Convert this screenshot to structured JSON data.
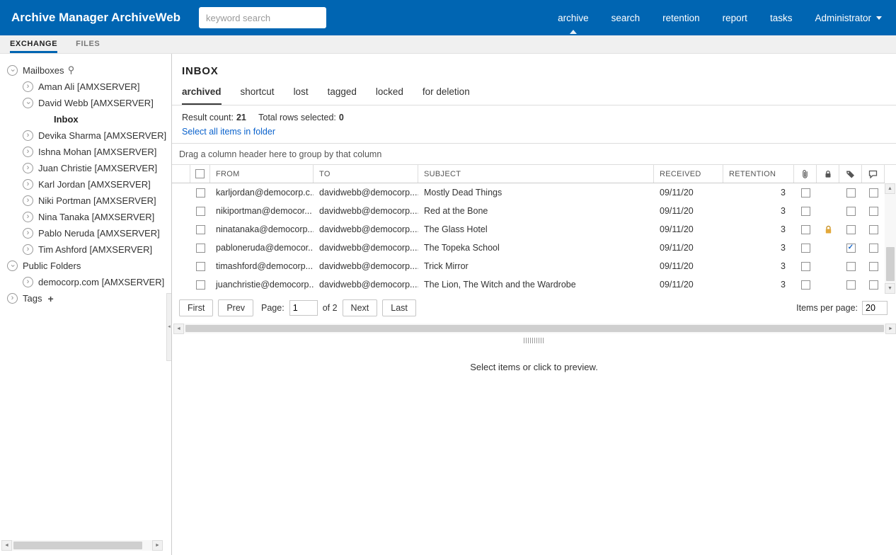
{
  "colors": {
    "accent": "#0065b2",
    "link": "#0a62cc",
    "lock_icon": "#e3a83a",
    "check": "#1464c8"
  },
  "glyphs": {
    "up": "▲",
    "down": "▼",
    "left": "◄",
    "right": "►",
    "chevron": "›",
    "check": "✓",
    "plus": "+"
  },
  "header": {
    "title": "Archive Manager ArchiveWeb",
    "search": {
      "placeholder": "keyword search"
    },
    "nav": [
      {
        "label": "archive",
        "active": true,
        "caret": "up"
      },
      {
        "label": "search"
      },
      {
        "label": "retention"
      },
      {
        "label": "report"
      },
      {
        "label": "tasks"
      },
      {
        "label": "Administrator",
        "caret": "down"
      }
    ]
  },
  "module_tabs": [
    {
      "label": "EXCHANGE",
      "active": true
    },
    {
      "label": "FILES",
      "active": false
    }
  ],
  "sidebar": {
    "tree": [
      {
        "label": "Mailboxes",
        "level": 0,
        "state": "expanded",
        "pin": true
      },
      {
        "label": "Aman Ali [AMXSERVER]",
        "level": 1,
        "state": "collapsed"
      },
      {
        "label": "David Webb [AMXSERVER]",
        "level": 1,
        "state": "expanded"
      },
      {
        "label": "Inbox",
        "level": 2,
        "selected": true
      },
      {
        "label": "Devika Sharma [AMXSERVER]",
        "level": 1,
        "state": "collapsed"
      },
      {
        "label": "Ishna Mohan [AMXSERVER]",
        "level": 1,
        "state": "collapsed"
      },
      {
        "label": "Juan Christie [AMXSERVER]",
        "level": 1,
        "state": "collapsed"
      },
      {
        "label": "Karl Jordan [AMXSERVER]",
        "level": 1,
        "state": "collapsed"
      },
      {
        "label": "Niki Portman [AMXSERVER]",
        "level": 1,
        "state": "collapsed"
      },
      {
        "label": "Nina Tanaka [AMXSERVER]",
        "level": 1,
        "state": "collapsed"
      },
      {
        "label": "Pablo Neruda [AMXSERVER]",
        "level": 1,
        "state": "collapsed"
      },
      {
        "label": "Tim Ashford [AMXSERVER]",
        "level": 1,
        "state": "collapsed"
      },
      {
        "label": "Public Folders",
        "level": 0,
        "state": "expanded"
      },
      {
        "label": "democorp.com [AMXSERVER]",
        "level": 1,
        "state": "collapsed"
      },
      {
        "label": "Tags",
        "level": 0,
        "state": "collapsed",
        "add": true
      }
    ]
  },
  "main": {
    "title": "INBOX",
    "view_tabs": [
      {
        "label": "archived",
        "active": true
      },
      {
        "label": "shortcut"
      },
      {
        "label": "lost"
      },
      {
        "label": "tagged"
      },
      {
        "label": "locked"
      },
      {
        "label": "for deletion"
      }
    ],
    "result_bar": {
      "result_count_label": "Result count:",
      "result_count": "21",
      "rows_selected_label": "Total rows selected:",
      "rows_selected": "0",
      "select_all_link": "Select all items in folder"
    },
    "group_hint": "Drag a column header here to group by that column",
    "table": {
      "columns": [
        "FROM",
        "TO",
        "SUBJECT",
        "RECEIVED",
        "RETENTION"
      ],
      "icon_columns": [
        "attachment",
        "lock",
        "tag",
        "comment"
      ],
      "rows": [
        {
          "from": "karljordan@democorp.c...",
          "to": "davidwebb@democorp....",
          "subject": "Mostly Dead Things",
          "received": "09/11/20",
          "retention": "3",
          "locked": false,
          "tagged": false
        },
        {
          "from": "nikiportman@democor...",
          "to": "davidwebb@democorp....",
          "subject": "Red at the Bone",
          "received": "09/11/20",
          "retention": "3",
          "locked": false,
          "tagged": false
        },
        {
          "from": "ninatanaka@democorp....",
          "to": "davidwebb@democorp....",
          "subject": "The Glass Hotel",
          "received": "09/11/20",
          "retention": "3",
          "locked": true,
          "tagged": false
        },
        {
          "from": "pabloneruda@democor...",
          "to": "davidwebb@democorp....",
          "subject": "The Topeka School",
          "received": "09/11/20",
          "retention": "3",
          "locked": false,
          "tagged": true
        },
        {
          "from": "timashford@democorp....",
          "to": "davidwebb@democorp....",
          "subject": "Trick Mirror",
          "received": "09/11/20",
          "retention": "3",
          "locked": false,
          "tagged": false
        },
        {
          "from": "juanchristie@democorp....",
          "to": "davidwebb@democorp....",
          "subject": "The Lion, The Witch and the Wardrobe",
          "received": "09/11/20",
          "retention": "3",
          "locked": false,
          "tagged": false
        }
      ]
    },
    "pagination": {
      "first": "First",
      "prev": "Prev",
      "page_label": "Page:",
      "page_value": "1",
      "of_label": "of 2",
      "next": "Next",
      "last": "Last",
      "items_per_page_label": "Items per page:",
      "items_per_page_value": "20"
    },
    "preview": {
      "empty_message": "Select items or click to preview."
    }
  }
}
